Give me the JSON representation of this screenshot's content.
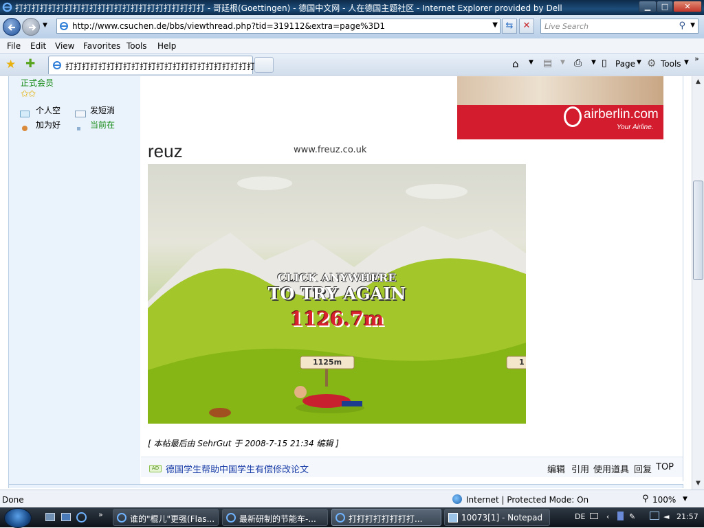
{
  "window": {
    "title": "打打打打打打打打打打打打打打打打打打打打打打打 - 哥廷根(Goettingen) - 德国中文网 - 人在德国主题社区 - Internet Explorer provided by Dell",
    "controls": {
      "minimize": "▁",
      "maximize": "□",
      "close": "✕"
    }
  },
  "address": {
    "url": "http://www.csuchen.de/bbs/viewthread.php?tid=319112&extra=page%3D1",
    "search_placeholder": "Live Search"
  },
  "menu": [
    "File",
    "Edit",
    "View",
    "Favorites",
    "Tools",
    "Help"
  ],
  "tab": {
    "label": "打打打打打打打打打打打打打打打打打打打打打打打..."
  },
  "toolbar": {
    "page_label": "Page",
    "tools_label": "Tools"
  },
  "sidebar": {
    "member_label": "正式会员",
    "stars": "✩✩",
    "links": [
      "个人空",
      "发短消",
      "加为好",
      "当前在"
    ]
  },
  "ad": {
    "brand": "airberlin.com",
    "slogan": "Your Airline."
  },
  "game": {
    "logo": "reuz",
    "site": "www.freuz.co.uk",
    "line1": "CLICK ANYWHERE",
    "line2": "TO TRY AGAIN",
    "distance": "1126.7m",
    "sign": "1125m",
    "sign2": "1"
  },
  "post": {
    "edit_note": "[ 本帖最后由  SehrGut  于  2008-7-15 21:34 编辑  ]",
    "ad_badge": "AD",
    "ad_link": "德国学生帮助中国学生有偿修改论文",
    "actions": [
      "编辑",
      "引用",
      "使用道具",
      "回复",
      "TOP"
    ]
  },
  "status": {
    "left": "Done",
    "zone": "Internet | Protected Mode: On",
    "zoom": "100%"
  },
  "taskbar": {
    "buttons": [
      {
        "label": "谁的\"棍儿\"更强(Flas..."
      },
      {
        "label": "最新研制的节能车-..."
      },
      {
        "label": "打打打打打打打打..."
      },
      {
        "label": "10073[1] - Notepad"
      }
    ],
    "lang": "DE",
    "clock": "21:57"
  }
}
